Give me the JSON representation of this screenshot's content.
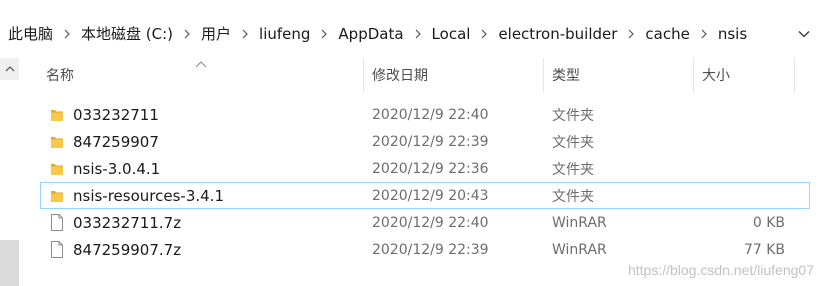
{
  "breadcrumb": {
    "items": [
      {
        "label": "此电脑"
      },
      {
        "label": "本地磁盘 (C:)"
      },
      {
        "label": "用户"
      },
      {
        "label": "liufeng"
      },
      {
        "label": "AppData"
      },
      {
        "label": "Local"
      },
      {
        "label": "electron-builder"
      },
      {
        "label": "cache"
      },
      {
        "label": "nsis"
      }
    ],
    "separator_icon": "chevron-right-icon",
    "dropdown_icon": "chevron-down-icon"
  },
  "columns": {
    "name": "名称",
    "date": "修改日期",
    "type": "类型",
    "size": "大小",
    "sort_icon": "sort-up-arrow-icon"
  },
  "files": [
    {
      "name": "033232711",
      "date": "2020/12/9 22:40",
      "type": "文件夹",
      "size": "",
      "icon": "folder-icon"
    },
    {
      "name": "847259907",
      "date": "2020/12/9 22:39",
      "type": "文件夹",
      "size": "",
      "icon": "folder-icon"
    },
    {
      "name": "nsis-3.0.4.1",
      "date": "2020/12/9 22:36",
      "type": "文件夹",
      "size": "",
      "icon": "folder-icon"
    },
    {
      "name": "nsis-resources-3.4.1",
      "date": "2020/12/9 20:43",
      "type": "文件夹",
      "size": "",
      "icon": "folder-icon"
    },
    {
      "name": "033232711.7z",
      "date": "2020/12/9 22:40",
      "type": "WinRAR",
      "size": "0 KB",
      "icon": "file-icon"
    },
    {
      "name": "847259907.7z",
      "date": "2020/12/9 22:39",
      "type": "WinRAR",
      "size": "77 KB",
      "icon": "file-icon"
    }
  ],
  "selected_file": "nsis-resources-3.4.1",
  "watermark": "https://blog.csdn.net/liufeng07",
  "colors": {
    "folder": "#f8c948",
    "folder_dark": "#e0a82e",
    "selection_border": "#99d1ff",
    "header_text": "#4d4d4d",
    "meta_text": "#6d6d6d"
  }
}
